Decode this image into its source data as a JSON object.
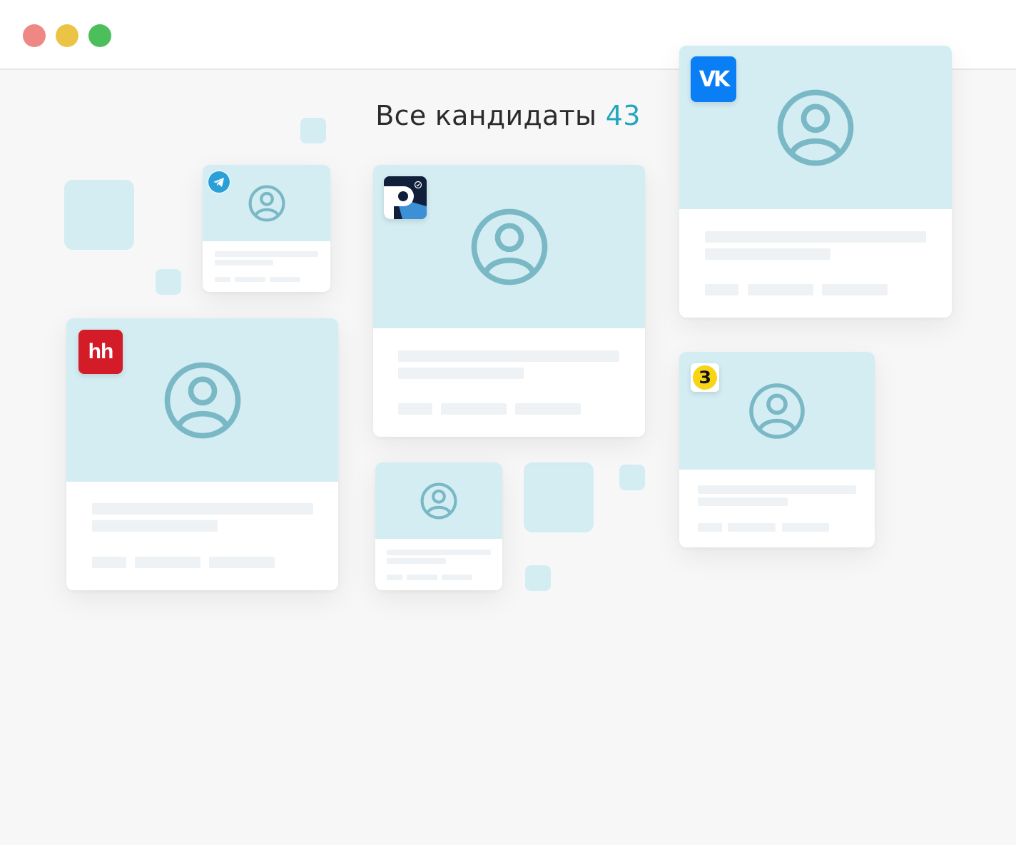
{
  "window": {
    "title_lights": [
      "close",
      "minimize",
      "maximize"
    ]
  },
  "header": {
    "title": "Все кандидаты",
    "count": "43"
  },
  "colors": {
    "accent": "#22a6bf",
    "photo_bg": "#d3edf3",
    "avatar": "#7ab8c6",
    "skeleton": "#eef2f4"
  },
  "sources": {
    "vk": {
      "icon": "vk-icon",
      "label": "VK"
    },
    "hh": {
      "icon": "hh-icon",
      "label": "hh"
    },
    "telegram": {
      "icon": "telegram-icon"
    },
    "rabota": {
      "icon": "rabota-icon"
    },
    "zarplata": {
      "icon": "zarplata-icon",
      "label": "З"
    }
  }
}
